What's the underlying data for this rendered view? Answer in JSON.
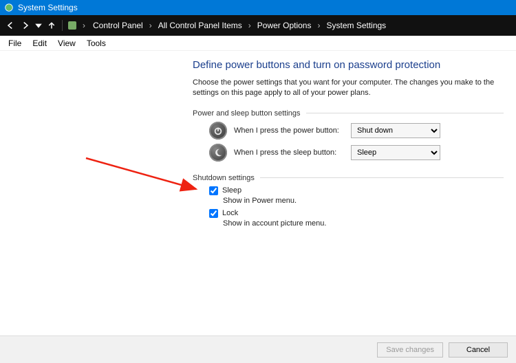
{
  "titlebar": {
    "title": "System Settings"
  },
  "nav": {
    "breadcrumb": [
      "Control Panel",
      "All Control Panel Items",
      "Power Options",
      "System Settings"
    ]
  },
  "menubar": {
    "items": [
      "File",
      "Edit",
      "View",
      "Tools"
    ]
  },
  "main": {
    "heading": "Define power buttons and turn on password protection",
    "description": "Choose the power settings that you want for your computer. The changes you make to the settings on this page apply to all of your power plans.",
    "section1": {
      "title": "Power and sleep button settings",
      "power_label": "When I press the power button:",
      "power_value": "Shut down",
      "sleep_label": "When I press the sleep button:",
      "sleep_value": "Sleep"
    },
    "section2": {
      "title": "Shutdown settings",
      "items": [
        {
          "label": "Sleep",
          "sub": "Show in Power menu.",
          "checked": true
        },
        {
          "label": "Lock",
          "sub": "Show in account picture menu.",
          "checked": true
        }
      ]
    }
  },
  "footer": {
    "save": "Save changes",
    "cancel": "Cancel"
  }
}
